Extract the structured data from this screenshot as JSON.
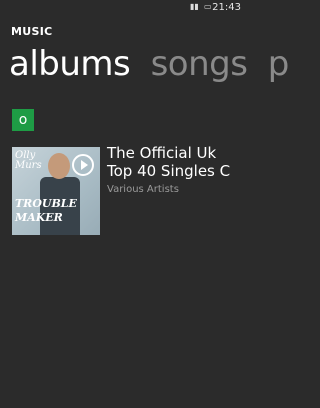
{
  "status": {
    "time": "21:43"
  },
  "app": {
    "title": "MUSIC"
  },
  "pivot": {
    "items": [
      "albums",
      "songs",
      "p"
    ]
  },
  "jump": {
    "letter": "o"
  },
  "album": {
    "title_line1": "The Official Uk",
    "title_line2": "Top 40 Singles C",
    "artist": "Various Artists",
    "cover": {
      "line1": "Olly",
      "line2": "Murs",
      "line3": "TROUBLE",
      "line4": "MAKER"
    }
  }
}
